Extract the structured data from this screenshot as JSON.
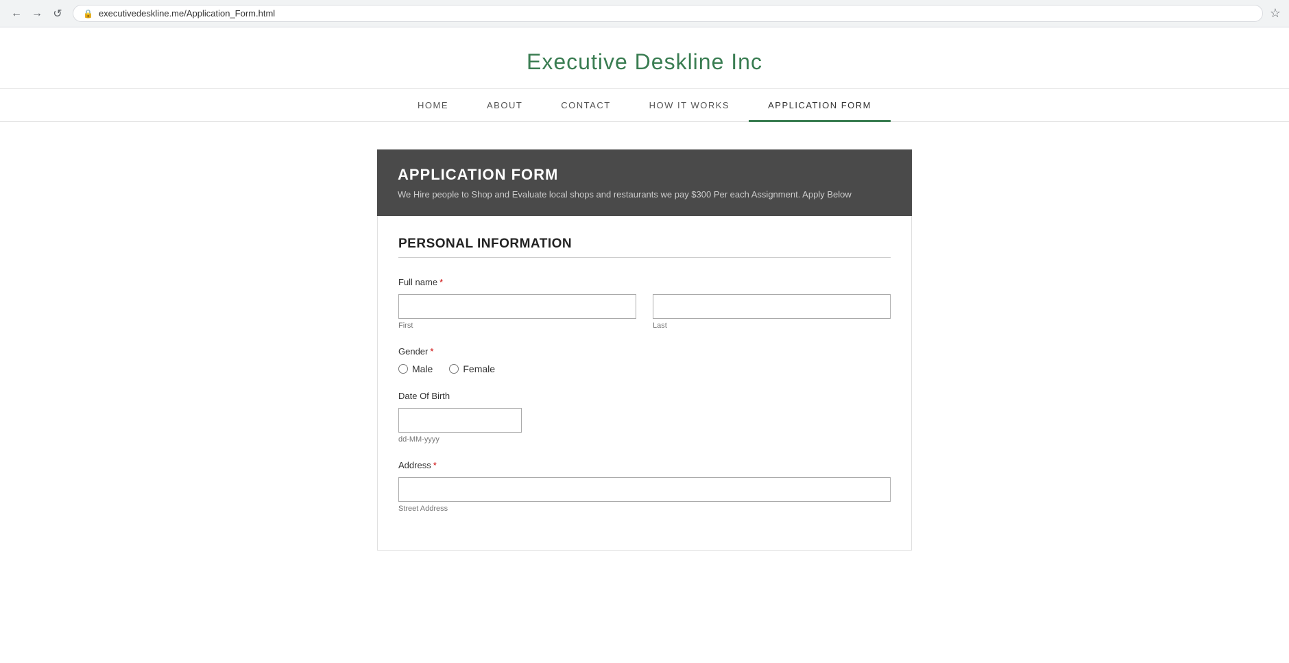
{
  "browser": {
    "url": "executivedeskline.me/Application_Form.html",
    "back_btn": "←",
    "forward_btn": "→",
    "reload_btn": "↺",
    "star_icon": "☆"
  },
  "site": {
    "title": "Executive Deskline Inc"
  },
  "nav": {
    "items": [
      {
        "id": "home",
        "label": "HOME",
        "active": false
      },
      {
        "id": "about",
        "label": "ABOUT",
        "active": false
      },
      {
        "id": "contact",
        "label": "CONTACT",
        "active": false
      },
      {
        "id": "how-it-works",
        "label": "HOW IT WORKS",
        "active": false
      },
      {
        "id": "application-form",
        "label": "APPLICATION FORM",
        "active": true
      }
    ]
  },
  "form": {
    "header_title": "APPLICATION FORM",
    "header_subtitle": "We Hire people to Shop and Evaluate local shops and restaurants we pay $300 Per each Assignment. Apply Below",
    "section_title": "PERSONAL INFORMATION",
    "fields": {
      "full_name": {
        "label": "Full name",
        "required": true,
        "first_placeholder": "",
        "first_sublabel": "First",
        "last_placeholder": "",
        "last_sublabel": "Last"
      },
      "gender": {
        "label": "Gender",
        "required": true,
        "options": [
          "Male",
          "Female"
        ]
      },
      "date_of_birth": {
        "label": "Date Of Birth",
        "required": false,
        "placeholder": "dd-MM-yyyy"
      },
      "address": {
        "label": "Address",
        "required": true,
        "placeholder": "Street Address"
      }
    }
  }
}
